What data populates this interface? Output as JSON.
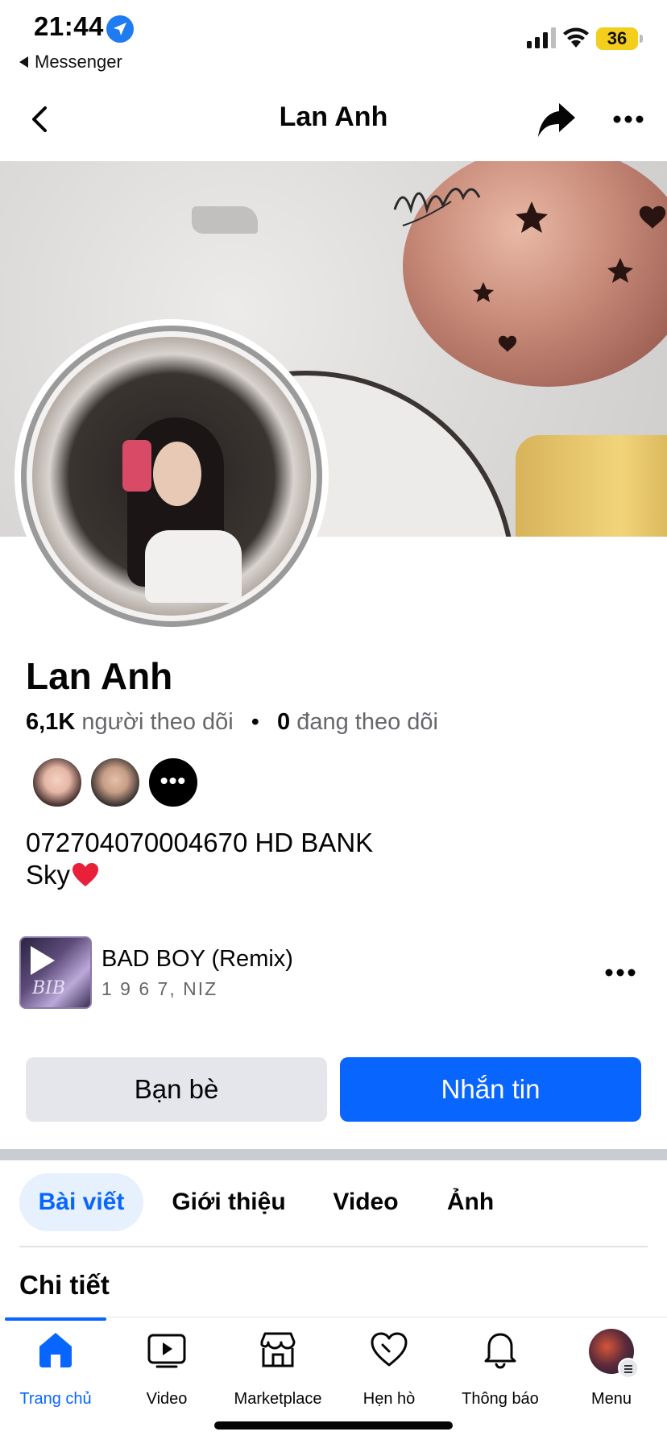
{
  "status_bar": {
    "time": "21:44",
    "back_app": "Messenger",
    "battery": "36",
    "icons": [
      "location-icon",
      "signal-icon",
      "wifi-icon",
      "battery-icon"
    ]
  },
  "header": {
    "title": "Lan Anh",
    "icons": [
      "back-arrow-icon",
      "share-icon",
      "more-icon"
    ]
  },
  "profile": {
    "name": "Lan Anh",
    "followers_count": "6,1K",
    "followers_label": "người theo dõi",
    "following_count": "0",
    "following_label": "đang theo dõi",
    "bio_line1": "072704070004670 HD BANK",
    "bio_line2": "Sky"
  },
  "music": {
    "title": "BAD BOY (Remix)",
    "artist": "1 9 6 7, NIZ",
    "art_text": "BIB"
  },
  "actions": {
    "friends_label": "Bạn bè",
    "message_label": "Nhắn tin"
  },
  "tabs": [
    {
      "label": "Bài viết",
      "active": true
    },
    {
      "label": "Giới thiệu",
      "active": false
    },
    {
      "label": "Video",
      "active": false
    },
    {
      "label": "Ảnh",
      "active": false
    }
  ],
  "section_title": "Chi tiết",
  "bottom_nav": [
    {
      "label": "Trang chủ",
      "icon": "home-icon",
      "active": true
    },
    {
      "label": "Video",
      "icon": "video-icon",
      "active": false
    },
    {
      "label": "Marketplace",
      "icon": "marketplace-icon",
      "active": false
    },
    {
      "label": "Hẹn hò",
      "icon": "heart-icon",
      "active": false
    },
    {
      "label": "Thông báo",
      "icon": "bell-icon",
      "active": false
    },
    {
      "label": "Menu",
      "icon": "menu-avatar-icon",
      "active": false
    }
  ],
  "colors": {
    "accent": "#0866ff",
    "button_secondary": "#e4e6eb",
    "battery": "#f3cf1c",
    "text_secondary": "#65676b"
  }
}
